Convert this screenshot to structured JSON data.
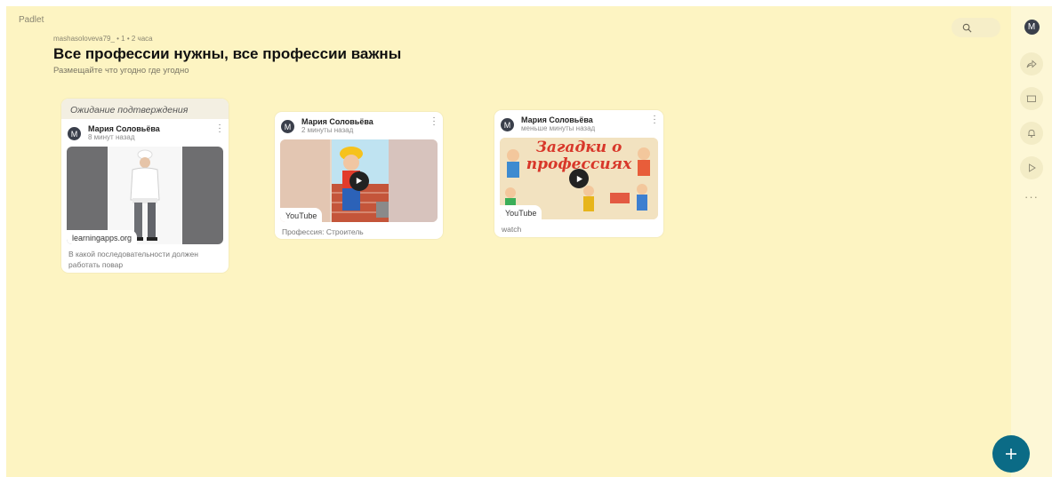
{
  "brand": "Padlet",
  "board": {
    "meta": "mashasoloveva79_ • 1 • 2 часа",
    "title": "Все профессии нужны, все профессии важны",
    "subtitle": "Размещайте что угодно где угодно"
  },
  "rail": {
    "avatar_letter": "M",
    "more": "···"
  },
  "posts": [
    {
      "status": "Ожидание подтверждения",
      "avatar_letter": "M",
      "author": "Мария Соловьёва",
      "time": "8 минут назад",
      "source": "learningapps.org",
      "caption": "В какой последовательности должен работать повар"
    },
    {
      "avatar_letter": "M",
      "author": "Мария Соловьёва",
      "time": "2 минуты назад",
      "source": "YouTube",
      "caption": "Профессия: Строитель"
    },
    {
      "avatar_letter": "M",
      "author": "Мария Соловьёва",
      "time": "меньше минуты назад",
      "thumbnail_text_line1": "Загадки о",
      "thumbnail_text_line2": "профессиях",
      "source": "YouTube",
      "caption": "watch"
    }
  ],
  "colors": {
    "background": "#fdf4c2",
    "fab": "#0b6b86",
    "avatar": "#3a3f4b"
  }
}
